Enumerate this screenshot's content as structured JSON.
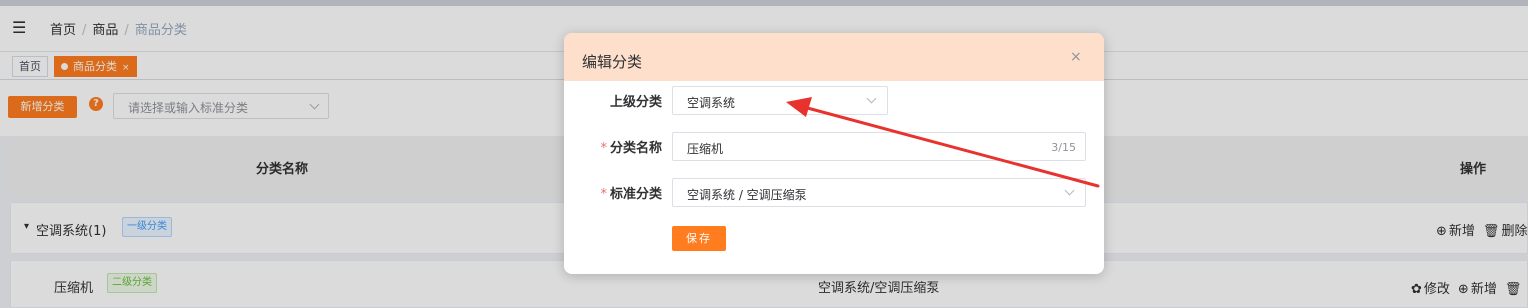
{
  "header": {
    "menu_icon": "menu-fold-icon",
    "breadcrumb": [
      "首页",
      "商品",
      "商品分类"
    ],
    "separator": "/"
  },
  "tags": {
    "home": "首页",
    "active": "商品分类",
    "close": "×"
  },
  "toolbar": {
    "add_label": "新增分类",
    "help_icon": "question-circle-icon",
    "help_glyph": "?",
    "standard_placeholder": "请选择或输入标准分类"
  },
  "table": {
    "columns": {
      "name": "分类名称",
      "operation": "操作"
    },
    "rows": [
      {
        "caret": "▾",
        "name": "空调系统(1)",
        "level": "一级分类",
        "standard": "",
        "ops": {
          "add": "新增",
          "delete": "删除"
        }
      },
      {
        "name": "压缩机",
        "level": "二级分类",
        "standard": "空调系统/空调压缩泵",
        "ops": {
          "edit": "修改",
          "add": "新增"
        }
      }
    ]
  },
  "dialog": {
    "title": "编辑分类",
    "close": "×",
    "required_mark": "*",
    "fields": {
      "parent_label": "上级分类",
      "parent_value": "空调系统",
      "name_label": "分类名称",
      "name_value": "压缩机",
      "name_count": "3/15",
      "standard_label": "标准分类",
      "standard_value": "空调系统 / 空调压缩泵"
    },
    "save_label": "保存"
  },
  "colors": {
    "accent": "#ff7d1f",
    "dialog_header": "#fddfcb",
    "annotation_arrow": "#e8322d",
    "level1_tag": "#409eff",
    "level2_tag": "#67c23a"
  }
}
